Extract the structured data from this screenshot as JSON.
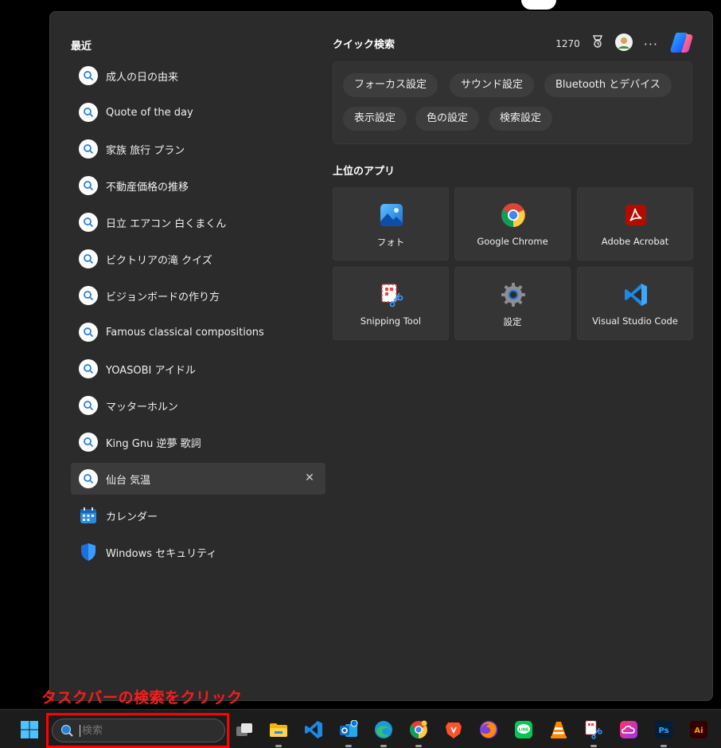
{
  "recent": {
    "title": "最近",
    "items": [
      {
        "label": "成人の日の由来",
        "kind": "search"
      },
      {
        "label": "Quote of the day",
        "kind": "search"
      },
      {
        "label": "家族 旅行 プラン",
        "kind": "search"
      },
      {
        "label": "不動産価格の推移",
        "kind": "search"
      },
      {
        "label": "日立 エアコン 白くまくん",
        "kind": "search"
      },
      {
        "label": "ビクトリアの滝 クイズ",
        "kind": "search"
      },
      {
        "label": "ビジョンボードの作り方",
        "kind": "search"
      },
      {
        "label": "Famous classical compositions",
        "kind": "search"
      },
      {
        "label": "YOASOBI アイドル",
        "kind": "search"
      },
      {
        "label": "マッターホルン",
        "kind": "search"
      },
      {
        "label": "King Gnu 逆夢 歌詞",
        "kind": "search"
      },
      {
        "label": "仙台 気温",
        "kind": "search",
        "active": true
      },
      {
        "label": "カレンダー",
        "kind": "calendar-app"
      },
      {
        "label": "Windows セキュリティ",
        "kind": "security-app"
      }
    ],
    "close_glyph": "✕"
  },
  "quick_search": {
    "title": "クイック検索",
    "points": "1270",
    "more": "···",
    "chips": [
      "フォーカス設定",
      "サウンド設定",
      "Bluetooth とデバイス",
      "表示設定",
      "色の設定",
      "検索設定"
    ]
  },
  "top_apps": {
    "title": "上位のアプリ",
    "apps": [
      {
        "label": "フォト",
        "icon": "photos-icon"
      },
      {
        "label": "Google Chrome",
        "icon": "chrome-icon"
      },
      {
        "label": "Adobe Acrobat",
        "icon": "acrobat-icon"
      },
      {
        "label": "Snipping Tool",
        "icon": "snipping-tool-icon"
      },
      {
        "label": "設定",
        "icon": "settings-icon"
      },
      {
        "label": "Visual Studio Code",
        "icon": "vscode-icon"
      }
    ]
  },
  "callout": "タスクバーの検索をクリック",
  "taskbar": {
    "search_placeholder": "検索",
    "apps": [
      "task-view-icon",
      "file-explorer-icon",
      "vscode-icon",
      "outlook-icon",
      "edge-icon",
      "chrome-canary-icon",
      "brave-icon",
      "firefox-icon",
      "line-icon",
      "vlc-icon",
      "snipping-tool-icon",
      "creative-cloud-icon",
      "photoshop-icon",
      "illustrator-icon"
    ]
  },
  "colors": {
    "accent": "#0078d4",
    "callout": "#ff1a1a",
    "panel": "#2b2b2b"
  }
}
